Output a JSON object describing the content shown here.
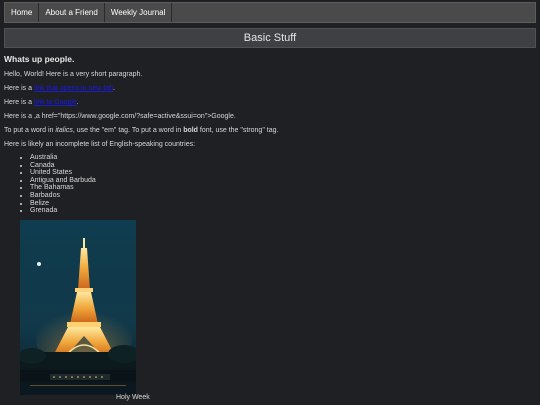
{
  "nav": {
    "items": [
      "Home",
      "About a Friend",
      "Weekly Journal"
    ]
  },
  "header": {
    "title": "Basic Stuff"
  },
  "main": {
    "heading": "Whats up people.",
    "p1": "Hello, World! Here is a very short paragraph.",
    "p2_prefix": "Here is a ",
    "p2_link": "link that opens in new tab",
    "p2_suffix": ".",
    "p3_prefix": "Here is a ",
    "p3_link": "link to Google",
    "p3_suffix": ".",
    "p4": "Here is a ,a href=\"https://www.google.com/?safe=active&ssui=on\">Google.",
    "p5_a": "To put a word in ",
    "p5_italics": "italics",
    "p5_b": ", use the \"em\" tag. To put a word in ",
    "p5_bold": "bold",
    "p5_c": " font, use the \"strong\" tag.",
    "p6": "Here is likely an incomplete list of English-speaking countries:",
    "countries": [
      "Australia",
      "Canada",
      "United States",
      "Antigua and Barbuda",
      "The Bahamas",
      "Barbados",
      "Belize",
      "Grenada"
    ]
  },
  "image": {
    "subject": "eiffel-tower-night-photo",
    "caption": "Holy Week"
  },
  "colors": {
    "background": "#1f2023",
    "nav": "#4a4a4a",
    "link": "#1a1adf"
  }
}
